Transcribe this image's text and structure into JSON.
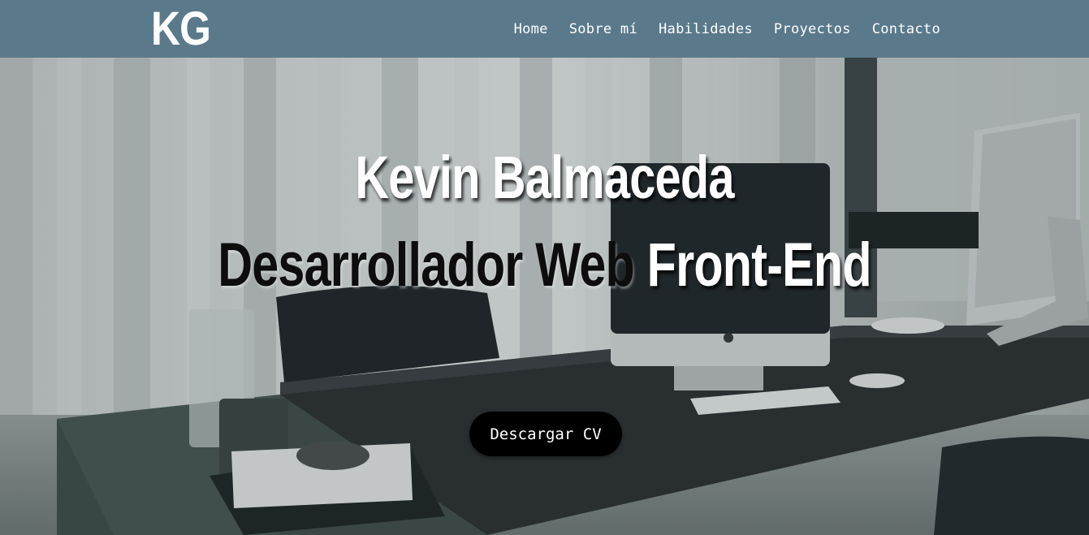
{
  "brand": {
    "logo": "KG"
  },
  "nav": {
    "items": [
      {
        "label": "Home"
      },
      {
        "label": "Sobre mí"
      },
      {
        "label": "Habilidades"
      },
      {
        "label": "Proyectos"
      },
      {
        "label": "Contacto"
      }
    ]
  },
  "hero": {
    "name": "Kevin Balmaceda",
    "role_part1": "Desarrollador Web",
    "role_part2": "Front-End",
    "cv_button": "Descargar CV",
    "background_image": "office-desk-photo"
  },
  "colors": {
    "navbar": "#5a7a8c",
    "button": "#000000",
    "text_light": "#ffffff",
    "text_dark": "#0d0d0d"
  }
}
